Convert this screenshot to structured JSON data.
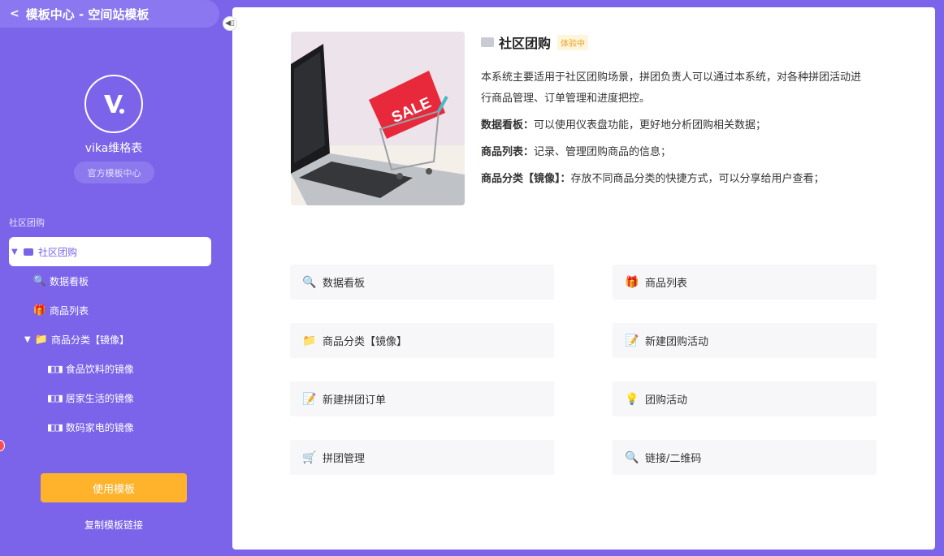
{
  "header": {
    "back_icon": "chevron-left-icon",
    "title": "模板中心 - 空间站模板"
  },
  "brand": {
    "name": "vika维格表",
    "badge": "官方模板中心"
  },
  "sidebar": {
    "section_title": "社区团购",
    "tree": [
      {
        "label": "社区团购",
        "icon": "folder-icon",
        "level": 0,
        "expanded": true,
        "active": true
      },
      {
        "label": "数据看板",
        "icon": "magnifier-icon",
        "level": 1
      },
      {
        "label": "商品列表",
        "icon": "gift-icon",
        "level": 1
      },
      {
        "label": "商品分类【镜像】",
        "icon": "folder-icon",
        "level": 1,
        "expanded": true
      },
      {
        "label": "食品饮料的镜像",
        "icon": "mirror-icon",
        "level": 2
      },
      {
        "label": "居家生活的镜像",
        "icon": "mirror-icon",
        "level": 2
      },
      {
        "label": "数码家电的镜像",
        "icon": "mirror-icon",
        "level": 2
      }
    ],
    "use_button": "使用模板",
    "copy_link": "复制模板链接"
  },
  "intro": {
    "title": "社区团购",
    "tag": "体验中",
    "desc_main": "本系统主要适用于社区团购场景，拼团负责人可以通过本系统，对各种拼团活动进行商品管理、订单管理和进度把控。",
    "items": [
      {
        "label": "数据看板：",
        "text": "可以使用仪表盘功能，更好地分析团购相关数据；"
      },
      {
        "label": "商品列表：",
        "text": "记录、管理团购商品的信息；"
      },
      {
        "label": "商品分类【镜像】：",
        "text": "存放不同商品分类的快捷方式，可以分享给用户查看；"
      }
    ]
  },
  "cards": [
    {
      "label": "数据看板",
      "icon": "magnifier-icon"
    },
    {
      "label": "商品列表",
      "icon": "gift-icon"
    },
    {
      "label": "商品分类【镜像】",
      "icon": "folder-icon"
    },
    {
      "label": "新建团购活动",
      "icon": "memo-icon"
    },
    {
      "label": "新建拼团订单",
      "icon": "memo-icon"
    },
    {
      "label": "团购活动",
      "icon": "lightbulb-icon"
    },
    {
      "label": "拼团管理",
      "icon": "cart-icon"
    },
    {
      "label": "链接/二维码",
      "icon": "magnifier-icon"
    }
  ],
  "colors": {
    "brand": "#7b64ea",
    "accent": "#ffb32d",
    "tag": "#f0a020"
  }
}
